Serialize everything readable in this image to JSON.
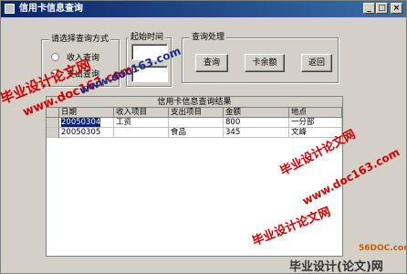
{
  "window": {
    "title": "信用卡信息查询"
  },
  "query_method": {
    "label": "请选择查询方式",
    "options": [
      "收入查询",
      "支出查询"
    ]
  },
  "date_group": {
    "label": "起始时间",
    "start_value": "",
    "end_value": ""
  },
  "actions": {
    "label": "查询处理",
    "query_label": "查询",
    "balance_label": "卡余额",
    "back_label": "返回"
  },
  "grid": {
    "caption": "信用卡信息查询结果",
    "columns": [
      "日期",
      "收入项目",
      "支出项目",
      "金额",
      "地点"
    ],
    "rows": [
      [
        "20050304",
        "工资",
        "",
        "800",
        "一分部"
      ],
      [
        "20050305",
        "",
        "食品",
        "345",
        "文峰"
      ]
    ]
  },
  "watermarks": {
    "site1": "毕业设计论文网",
    "url1": "www.doc163.com",
    "url2": "www.doc163.com",
    "site2": "毕业设计论文网",
    "site3": "毕业设计论文网",
    "url3": "www.doc163.com",
    "footer_brand": "56DOC.com",
    "footer_cn": "毕业设计(论文)网"
  }
}
